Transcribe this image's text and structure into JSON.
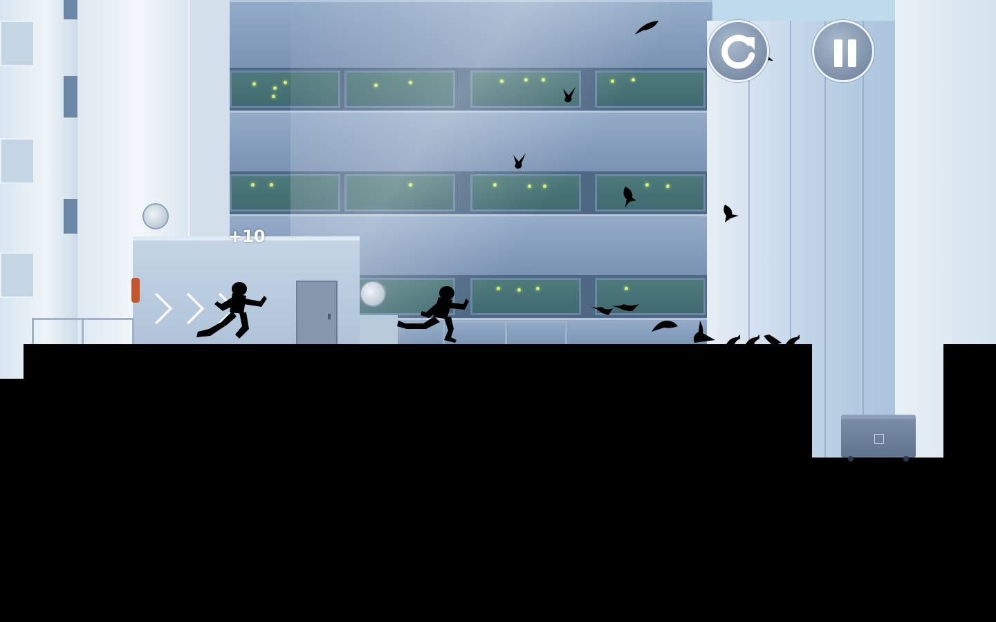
{
  "game": {
    "score_popup": "+10"
  },
  "hud": {
    "restart_icon": "restart-icon",
    "pause_icon": "pause-icon"
  },
  "colors": {
    "sky": "#bfdaea",
    "building_blue": "#7f98b8",
    "window_glow": "#d8f070",
    "silhouette": "#000000",
    "hud_button_fill": "#7d90a8",
    "hud_button_border": "#eef3f8"
  }
}
